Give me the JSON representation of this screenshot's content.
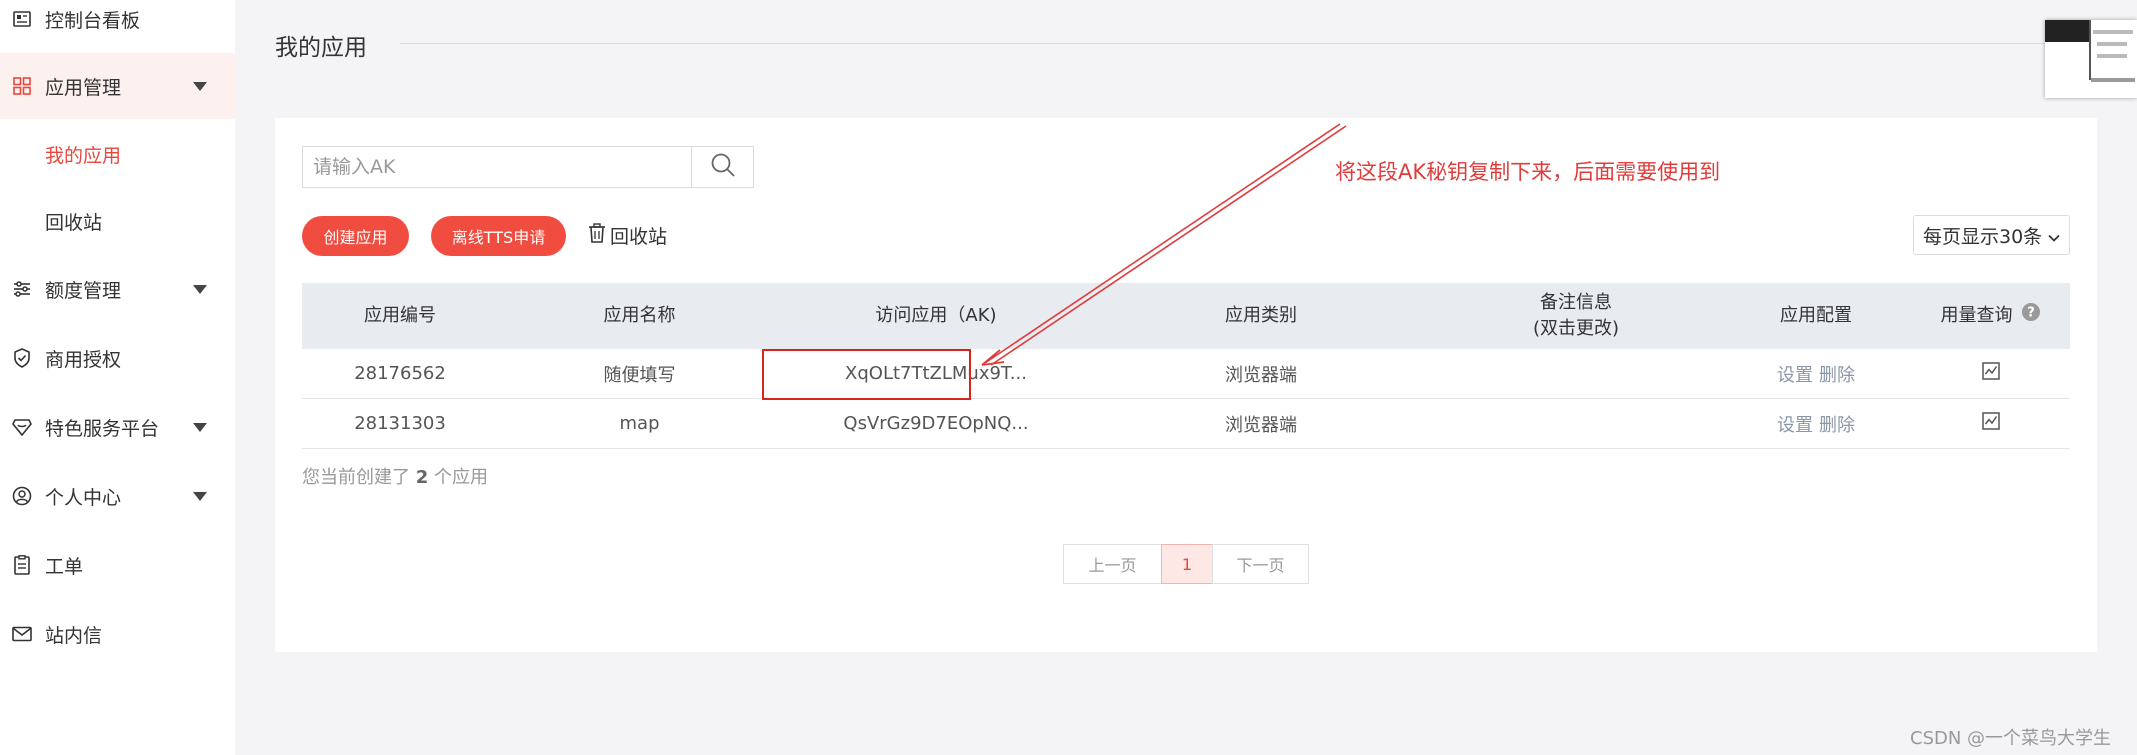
{
  "sidebar": {
    "items": [
      {
        "label": "控制台看板",
        "icon": "dashboard-card-icon"
      },
      {
        "label": "应用管理",
        "icon": "grid-apps-icon"
      },
      {
        "label": "额度管理",
        "icon": "sliders-icon"
      },
      {
        "label": "商用授权",
        "icon": "shield-check-icon"
      },
      {
        "label": "特色服务平台",
        "icon": "heart-shield-icon"
      },
      {
        "label": "个人中心",
        "icon": "user-circle-icon"
      },
      {
        "label": "工单",
        "icon": "clipboard-icon"
      },
      {
        "label": "站内信",
        "icon": "mail-icon"
      }
    ],
    "sub_items": [
      {
        "label": "我的应用"
      },
      {
        "label": "回收站"
      }
    ]
  },
  "page": {
    "title": "我的应用"
  },
  "search": {
    "placeholder": "请输入AK"
  },
  "toolbar": {
    "create_label": "创建应用",
    "tts_label": "离线TTS申请",
    "recycle_label": "回收站",
    "page_size_label": "每页显示30条"
  },
  "annotation": {
    "text": "将这段AK秘钥复制下来，后面需要使用到",
    "color": "#e03c3c"
  },
  "table": {
    "headers": {
      "id": "应用编号",
      "name": "应用名称",
      "ak": "访问应用（AK)",
      "type": "应用类别",
      "remark_line1": "备注信息",
      "remark_line2": "(双击更改)",
      "config": "应用配置",
      "usage": "用量查询"
    },
    "rows": [
      {
        "id": "28176562",
        "name": "随便填写",
        "ak": "XqOLt7TtZLMux9T...",
        "type": "浏览器端",
        "remark": "",
        "set": "设置",
        "del": "删除"
      },
      {
        "id": "28131303",
        "name": "map",
        "ak": "QsVrGz9D7EOpNQ...",
        "type": "浏览器端",
        "remark": "",
        "set": "设置",
        "del": "删除"
      }
    ],
    "summary_prefix": "您当前创建了",
    "summary_count": "2",
    "summary_suffix": "个应用"
  },
  "pagination": {
    "prev": "上一页",
    "current": "1",
    "next": "下一页"
  },
  "watermark": "CSDN @一个菜鸟大学生",
  "colors": {
    "accent": "#f04c3f",
    "active_text": "#e8473d",
    "header_bg": "#e8ebf0"
  }
}
